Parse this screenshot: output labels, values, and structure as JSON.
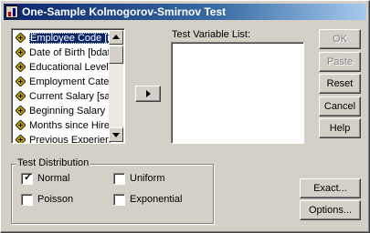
{
  "window": {
    "title": "One-Sample Kolmogorov-Smirnov Test"
  },
  "source_list": {
    "items": [
      {
        "label": "Employee Code [id",
        "selected": true
      },
      {
        "label": "Date of Birth [bdate",
        "selected": false
      },
      {
        "label": "Educational Level (",
        "selected": false
      },
      {
        "label": "Employment Categc",
        "selected": false
      },
      {
        "label": "Current Salary [sala",
        "selected": false
      },
      {
        "label": "Beginning Salary [s",
        "selected": false
      },
      {
        "label": "Months since Hire [",
        "selected": false
      },
      {
        "label": "Previous Experienc",
        "selected": false
      }
    ],
    "scroll_up_icon": "triangle-up",
    "scroll_down_icon": "triangle-down",
    "variable_icon": "ruler-diamond-icon"
  },
  "move_button": {
    "icon": "right-arrow"
  },
  "test_variable_list": {
    "label": "Test Variable List:"
  },
  "buttons": {
    "ok": {
      "label": "OK",
      "enabled": false
    },
    "paste": {
      "label": "Paste",
      "enabled": false
    },
    "reset": {
      "label": "Reset",
      "enabled": true
    },
    "cancel": {
      "label": "Cancel",
      "enabled": true
    },
    "help": {
      "label": "Help",
      "enabled": true
    },
    "exact": {
      "label": "Exact...",
      "enabled": true
    },
    "options": {
      "label": "Options...",
      "enabled": true
    }
  },
  "test_distribution": {
    "legend": "Test Distribution",
    "normal": {
      "label": "Normal",
      "checked": true
    },
    "uniform": {
      "label": "Uniform",
      "checked": false
    },
    "poisson": {
      "label": "Poisson",
      "checked": false
    },
    "exponential": {
      "label": "Exponential",
      "checked": false
    },
    "check_mark": "✓"
  },
  "colors": {
    "dialog_bg": "#d4d0c8",
    "title_start": "#0a246a",
    "title_end": "#a6caf0",
    "selection": "#0a246a",
    "variable_icon": "#c8a000"
  }
}
